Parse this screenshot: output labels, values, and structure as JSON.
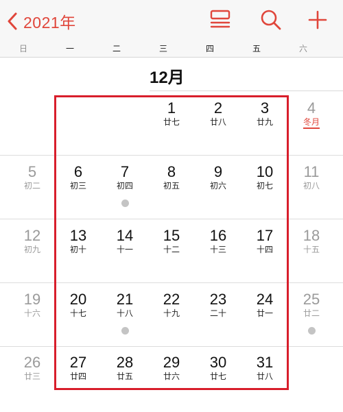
{
  "header": {
    "back_label": "2021年",
    "icons": {
      "back": "chevron-left-icon",
      "list": "list-view-icon",
      "search": "search-icon",
      "add": "plus-icon"
    },
    "accent_color": "#e0463b"
  },
  "weekdays": [
    "日",
    "一",
    "二",
    "三",
    "四",
    "五",
    "六"
  ],
  "month": {
    "title": "12月"
  },
  "weeks": [
    [
      null,
      null,
      null,
      {
        "day": "1",
        "lunar": "廿七"
      },
      {
        "day": "2",
        "lunar": "廿八"
      },
      {
        "day": "3",
        "lunar": "廿九"
      },
      {
        "day": "4",
        "lunar": "冬月",
        "term": true
      }
    ],
    [
      {
        "day": "5",
        "lunar": "初二"
      },
      {
        "day": "6",
        "lunar": "初三"
      },
      {
        "day": "7",
        "lunar": "初四",
        "event": true
      },
      {
        "day": "8",
        "lunar": "初五"
      },
      {
        "day": "9",
        "lunar": "初六"
      },
      {
        "day": "10",
        "lunar": "初七"
      },
      {
        "day": "11",
        "lunar": "初八"
      }
    ],
    [
      {
        "day": "12",
        "lunar": "初九"
      },
      {
        "day": "13",
        "lunar": "初十"
      },
      {
        "day": "14",
        "lunar": "十一"
      },
      {
        "day": "15",
        "lunar": "十二"
      },
      {
        "day": "16",
        "lunar": "十三"
      },
      {
        "day": "17",
        "lunar": "十四"
      },
      {
        "day": "18",
        "lunar": "十五"
      }
    ],
    [
      {
        "day": "19",
        "lunar": "十六"
      },
      {
        "day": "20",
        "lunar": "十七"
      },
      {
        "day": "21",
        "lunar": "十八",
        "event": true
      },
      {
        "day": "22",
        "lunar": "十九"
      },
      {
        "day": "23",
        "lunar": "二十"
      },
      {
        "day": "24",
        "lunar": "廿一"
      },
      {
        "day": "25",
        "lunar": "廿二",
        "event": true
      }
    ],
    [
      {
        "day": "26",
        "lunar": "廿三"
      },
      {
        "day": "27",
        "lunar": "廿四"
      },
      {
        "day": "28",
        "lunar": "廿五"
      },
      {
        "day": "29",
        "lunar": "廿六"
      },
      {
        "day": "30",
        "lunar": "廿七"
      },
      {
        "day": "31",
        "lunar": "廿八"
      },
      null
    ]
  ],
  "highlight_color": "#d81e2b"
}
